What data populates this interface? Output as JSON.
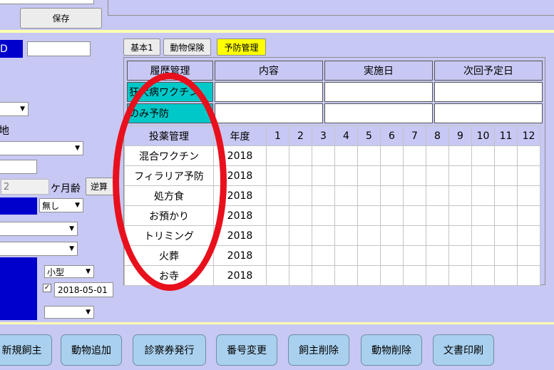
{
  "header": {
    "save_label": "保存"
  },
  "left": {
    "badge_text": "D",
    "fragment_label": "地",
    "age_value": "2",
    "age_unit": "ケ月齢",
    "reverse_calc_label": "逆算",
    "select_none": "無し",
    "size_select": "小型",
    "date_value": "2018-05-01",
    "checkbox_checked": true
  },
  "tabs": [
    {
      "label": "基本1",
      "active": false
    },
    {
      "label": "動物保険",
      "active": false
    },
    {
      "label": "予防管理",
      "active": true
    }
  ],
  "history_table": {
    "headers": [
      "履歴管理",
      "内容",
      "実施日",
      "次回予定日"
    ],
    "rows": [
      {
        "name": "狂犬病ワクチン",
        "content": "",
        "date": "",
        "next": ""
      },
      {
        "name": "のみ予防",
        "content": "",
        "date": "",
        "next": ""
      }
    ]
  },
  "medication_table": {
    "header_name": "投薬管理",
    "header_year": "年度",
    "months": [
      "1",
      "2",
      "3",
      "4",
      "5",
      "6",
      "7",
      "8",
      "9",
      "10",
      "11",
      "12"
    ],
    "rows": [
      {
        "name": "混合ワクチン",
        "year": "2018"
      },
      {
        "name": "フィラリア予防",
        "year": "2018"
      },
      {
        "name": "処方食",
        "year": "2018"
      },
      {
        "name": "お預かり",
        "year": "2018"
      },
      {
        "name": "トリミング",
        "year": "2018"
      },
      {
        "name": "火葬",
        "year": "2018"
      },
      {
        "name": "お寺",
        "year": "2018"
      }
    ]
  },
  "bottom_buttons": [
    "新規飼主",
    "動物追加",
    "診察券発行",
    "番号変更",
    "飼主削除",
    "動物削除",
    "文書印刷"
  ],
  "colors": {
    "background": "#c8c8f4",
    "active_tab": "#ffff00",
    "highlight_cyan": "#00c8c8",
    "annotation_red": "#e8101c",
    "bottom_button": "#a9d0ee",
    "left_blue": "#0000cd"
  }
}
